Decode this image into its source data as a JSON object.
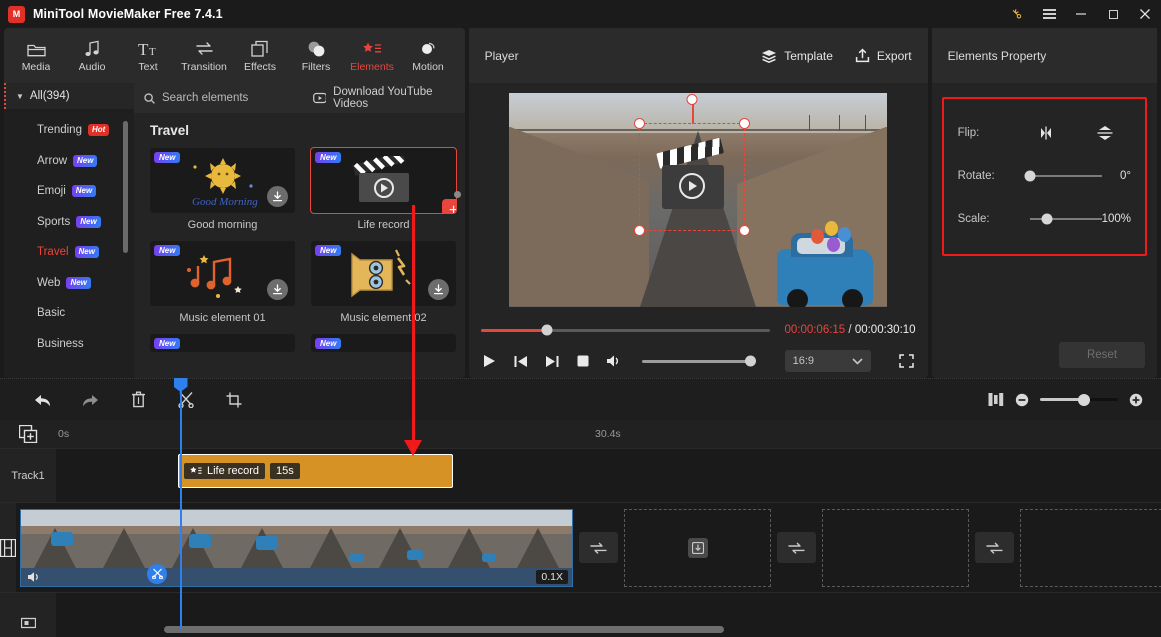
{
  "titlebar": {
    "app_name": "MiniTool MovieMaker Free 7.4.1",
    "logo_letter": "M",
    "icons": {
      "key": "key-icon",
      "menu": "hamburger-menu-icon",
      "minimize": "minimize-icon",
      "maximize": "maximize-icon",
      "close": "close-icon"
    }
  },
  "ribbon": {
    "items": [
      {
        "label": "Media",
        "icon": "folder-icon",
        "active": false
      },
      {
        "label": "Audio",
        "icon": "music-note-icon",
        "active": false
      },
      {
        "label": "Text",
        "icon": "text-icon",
        "active": false
      },
      {
        "label": "Transition",
        "icon": "transition-arrows-icon",
        "active": false
      },
      {
        "label": "Effects",
        "icon": "layers-square-icon",
        "active": false
      },
      {
        "label": "Filters",
        "icon": "filters-circles-icon",
        "active": false
      },
      {
        "label": "Elements",
        "icon": "star-list-icon",
        "active": true
      },
      {
        "label": "Motion",
        "icon": "motion-ellipse-icon",
        "active": false
      }
    ],
    "active_color": "#e8453c"
  },
  "categories": {
    "all_label": "All(394)",
    "items": [
      {
        "label": "Trending",
        "badge": "Hot",
        "badge_type": "hot",
        "active": false
      },
      {
        "label": "Arrow",
        "badge": "New",
        "badge_type": "new",
        "active": false
      },
      {
        "label": "Emoji",
        "badge": "New",
        "badge_type": "new",
        "active": false
      },
      {
        "label": "Sports",
        "badge": "New",
        "badge_type": "new",
        "active": false
      },
      {
        "label": "Travel",
        "badge": "New",
        "badge_type": "new",
        "active": true
      },
      {
        "label": "Web",
        "badge": "New",
        "badge_type": "new",
        "active": false
      },
      {
        "label": "Basic",
        "badge": "",
        "badge_type": "",
        "active": false
      },
      {
        "label": "Business",
        "badge": "",
        "badge_type": "",
        "active": false
      }
    ]
  },
  "elements_panel": {
    "search_placeholder": "Search elements",
    "search_value": "",
    "youtube_label": "Download YouTube Videos",
    "section_title": "Travel",
    "items": [
      {
        "label": "Good morning",
        "badge": "New",
        "state": "download",
        "selected": false
      },
      {
        "label": "Life record",
        "badge": "New",
        "state": "add",
        "selected": true
      },
      {
        "label": "Music element 01",
        "badge": "New",
        "state": "download",
        "selected": false
      },
      {
        "label": "Music element 02",
        "badge": "New",
        "state": "download",
        "selected": false
      }
    ]
  },
  "player": {
    "title": "Player",
    "template_label": "Template",
    "export_label": "Export",
    "current_time": "00:00:06:15",
    "separator": " / ",
    "total_time": "00:00:30:10",
    "aspect_ratio": "16:9",
    "progress_percent": 23,
    "controls": [
      "play-button",
      "previous-frame-button",
      "next-frame-button",
      "stop-button",
      "volume-button",
      "fullscreen-button"
    ]
  },
  "property_panel": {
    "title": "Elements Property",
    "flip_label": "Flip:",
    "flip_horizontal_icon": "flip-horizontal-icon",
    "flip_vertical_icon": "flip-vertical-icon",
    "rotate_label": "Rotate:",
    "rotate_value": "0°",
    "scale_label": "Scale:",
    "scale_value": "100%",
    "reset_label": "Reset",
    "highlight_color": "#f01a1a"
  },
  "timeline": {
    "toolbar_icons": [
      "undo-icon",
      "redo-icon",
      "delete-icon",
      "split-scissors-icon",
      "crop-icon"
    ],
    "split-view_icon": "split-view-icon",
    "zoom_out_icon": "zoom-out-icon",
    "zoom_in_icon": "zoom-in-icon",
    "ruler": {
      "start_label": "0s",
      "mid_label": "30.4s"
    },
    "add_track_icon": "add-track-icon",
    "track_label": "Track1",
    "element_clip": {
      "name": "Life record",
      "duration": "15s",
      "icon": "element-star-icon"
    },
    "video_track_icon": "film-strip-icon",
    "video_clip": {
      "speed_badge": "0.1X",
      "volume_icon": "volume-icon",
      "cut_icon": "scissors-icon"
    },
    "transition_icon": "transition-arrows-icon",
    "dropzone_icon": "download-box-icon",
    "bottom_track_icon": "sticker-track-icon"
  }
}
